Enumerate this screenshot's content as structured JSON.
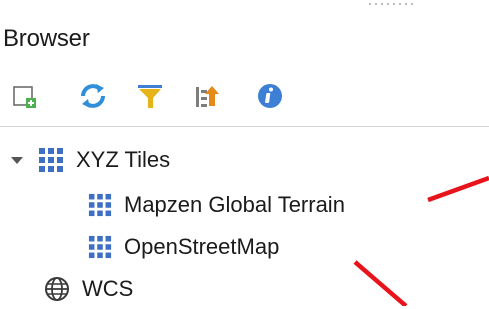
{
  "panel": {
    "title": "Browser"
  },
  "toolbar": [
    {
      "name": "add-layer-icon",
      "tooltip": "Add"
    },
    {
      "name": "refresh-icon",
      "tooltip": "Refresh"
    },
    {
      "name": "filter-icon",
      "tooltip": "Filter"
    },
    {
      "name": "collapse-all-icon",
      "tooltip": "Collapse"
    },
    {
      "name": "info-icon",
      "tooltip": "Info"
    }
  ],
  "tree": {
    "xyz": {
      "label": "XYZ Tiles",
      "expanded": true,
      "children": [
        {
          "label": "Mapzen Global Terrain"
        },
        {
          "label": "OpenStreetMap"
        }
      ]
    },
    "wcs": {
      "label": "WCS"
    }
  },
  "colors": {
    "xyz_icon": "#3f6fc5",
    "annotation": "#e8141b",
    "refresh": "#2f8fd8",
    "filter": "#e6b31b",
    "info": "#3d7fd4",
    "add": "#4caf50"
  }
}
